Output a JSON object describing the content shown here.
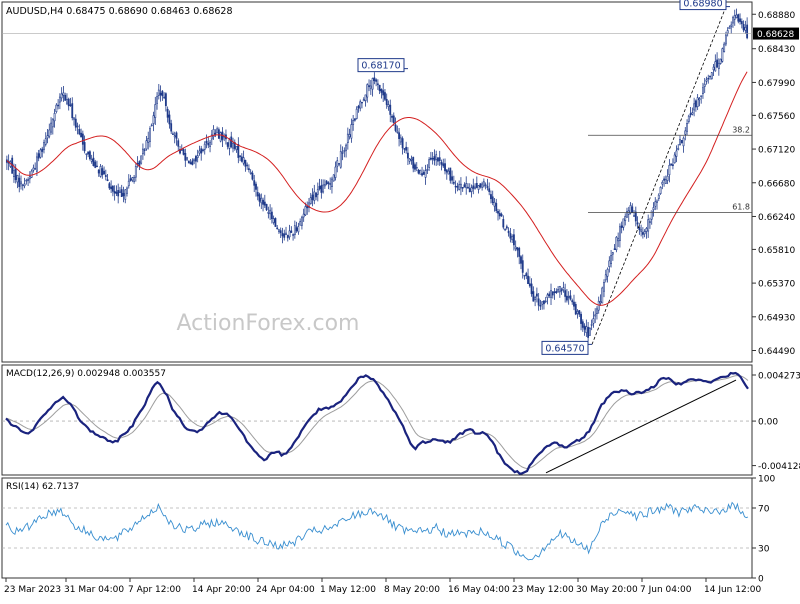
{
  "header": {
    "symbol": "AUDUSD,H4",
    "open": "0.68475",
    "high": "0.68690",
    "low": "0.68463",
    "close": "0.68628"
  },
  "watermark": "ActionForex.com",
  "colors": {
    "candle": "#1f3a8a",
    "ma": "#d42020",
    "macd": "#1a237e",
    "signal": "#9e9e9e",
    "rsi": "#3a8fd0",
    "grid": "#b0b0b0",
    "fib": "#444444"
  },
  "chart_data": [
    {
      "type": "candlestick",
      "panel": "price",
      "ylim": [
        0.6434,
        0.6904
      ],
      "y_ticks": [
        "0.68880",
        "0.68430",
        "0.67990",
        "0.67560",
        "0.67120",
        "0.66680",
        "0.66240",
        "0.65810",
        "0.65370",
        "0.64930",
        "0.64490"
      ],
      "x_ticks": [
        "23 Mar 2023",
        "31 Mar 04:00",
        "7 Apr 12:00",
        "14 Apr 20:00",
        "24 Apr 04:00",
        "1 May 12:00",
        "8 May 20:00",
        "16 May 04:00",
        "23 May 12:00",
        "30 May 20:00",
        "7 Jun 04:00",
        "14 Jun 12:00"
      ],
      "current_price": "0.68628",
      "path_closes": [
        0.6697,
        0.6682,
        0.6665,
        0.6672,
        0.669,
        0.6712,
        0.6738,
        0.676,
        0.6785,
        0.677,
        0.6742,
        0.6718,
        0.67,
        0.669,
        0.6678,
        0.666,
        0.665,
        0.6658,
        0.6672,
        0.669,
        0.6718,
        0.675,
        0.679,
        0.6768,
        0.673,
        0.6712,
        0.67,
        0.6695,
        0.671,
        0.672,
        0.6735,
        0.673,
        0.672,
        0.6712,
        0.67,
        0.6685,
        0.666,
        0.664,
        0.6628,
        0.661,
        0.66,
        0.6602,
        0.6612,
        0.663,
        0.665,
        0.6658,
        0.6662,
        0.6675,
        0.6698,
        0.672,
        0.6745,
        0.677,
        0.679,
        0.68,
        0.679,
        0.677,
        0.674,
        0.672,
        0.67,
        0.6688,
        0.6682,
        0.6692,
        0.67,
        0.669,
        0.6675,
        0.6668,
        0.6662,
        0.666,
        0.6665,
        0.6665,
        0.665,
        0.663,
        0.661,
        0.6595,
        0.657,
        0.6545,
        0.652,
        0.651,
        0.6515,
        0.6525,
        0.653,
        0.652,
        0.6505,
        0.649,
        0.647,
        0.649,
        0.6525,
        0.656,
        0.659,
        0.6615,
        0.6635,
        0.662,
        0.66,
        0.662,
        0.665,
        0.667,
        0.669,
        0.6712,
        0.6735,
        0.676,
        0.678,
        0.68,
        0.6815,
        0.683,
        0.686,
        0.6885,
        0.688,
        0.6863
      ],
      "swing_labels": [
        {
          "label": "0.68170",
          "value": 0.6817,
          "at": "8 May 20:00"
        },
        {
          "label": "0.64570",
          "value": 0.6457,
          "at": "30 May 20:00"
        },
        {
          "label": "0.68980",
          "value": 0.6898,
          "at": "14 Jun 12:00"
        }
      ],
      "fib_levels": [
        {
          "label": "38.2",
          "value": 0.673
        },
        {
          "label": "61.8",
          "value": 0.6629
        }
      ]
    },
    {
      "type": "line",
      "panel": "macd",
      "title": "MACD(12,26,9) 0.002948 0.003557",
      "ylim": [
        -0.005,
        0.0052
      ],
      "y_ticks": [
        "0.004273",
        "0.00",
        "-0.004128"
      ],
      "path_values": [
        0.0001,
        -0.0004,
        -0.0008,
        -0.0012,
        -0.0008,
        0.0002,
        0.001,
        0.0016,
        0.0022,
        0.0018,
        0.0008,
        -0.0002,
        -0.0008,
        -0.0012,
        -0.0016,
        -0.002,
        -0.0018,
        -0.0012,
        -0.0006,
        0.0004,
        0.0016,
        0.003,
        0.0036,
        0.0026,
        0.0012,
        0.0002,
        -0.0006,
        -0.001,
        -0.0008,
        -0.0002,
        0.0004,
        0.0008,
        0.0006,
        0.0,
        -0.001,
        -0.0022,
        -0.003,
        -0.0036,
        -0.0032,
        -0.0028,
        -0.0032,
        -0.0025,
        -0.0016,
        -0.0006,
        0.0004,
        0.001,
        0.0012,
        0.0012,
        0.0016,
        0.0024,
        0.0032,
        0.004,
        0.0042,
        0.0038,
        0.003,
        0.002,
        0.001,
        -0.0002,
        -0.0016,
        -0.0026,
        -0.002,
        -0.0018,
        -0.0016,
        -0.0018,
        -0.002,
        -0.0014,
        -0.001,
        -0.0008,
        -0.0012,
        -0.001,
        -0.0018,
        -0.003,
        -0.004,
        -0.0046,
        -0.0048,
        -0.0046,
        -0.0038,
        -0.003,
        -0.0024,
        -0.002,
        -0.0022,
        -0.0024,
        -0.002,
        -0.0016,
        -0.001,
        0.0002,
        0.0016,
        0.0024,
        0.0028,
        0.0028,
        0.0026,
        0.0026,
        0.0028,
        0.003,
        0.0036,
        0.004,
        0.0038,
        0.0034,
        0.0038,
        0.004,
        0.0038,
        0.0036,
        0.0037,
        0.004,
        0.0042,
        0.0045,
        0.004,
        0.003
      ],
      "trendline": [
        [
          -0.0048
        ],
        [
          0.0038
        ]
      ]
    },
    {
      "type": "line",
      "panel": "rsi",
      "title": "RSI(14) 62.7137",
      "ylim": [
        0,
        100
      ],
      "y_ticks": [
        "100",
        "70",
        "30",
        "0"
      ],
      "levels": [
        70,
        30
      ],
      "path_values": [
        55,
        48,
        46,
        50,
        56,
        62,
        64,
        66,
        68,
        60,
        52,
        48,
        45,
        42,
        40,
        38,
        40,
        45,
        50,
        56,
        62,
        66,
        72,
        62,
        54,
        50,
        48,
        48,
        52,
        54,
        56,
        55,
        52,
        50,
        46,
        42,
        38,
        36,
        35,
        33,
        32,
        34,
        38,
        42,
        46,
        48,
        48,
        50,
        54,
        58,
        62,
        64,
        66,
        68,
        64,
        58,
        52,
        48,
        46,
        46,
        46,
        48,
        50,
        46,
        44,
        44,
        44,
        45,
        46,
        46,
        42,
        38,
        34,
        30,
        24,
        22,
        20,
        26,
        34,
        40,
        44,
        40,
        36,
        32,
        28,
        40,
        54,
        62,
        66,
        70,
        66,
        62,
        64,
        66,
        68,
        70,
        70,
        66,
        68,
        70,
        68,
        66,
        66,
        68,
        70,
        72,
        68,
        62
      ]
    }
  ]
}
